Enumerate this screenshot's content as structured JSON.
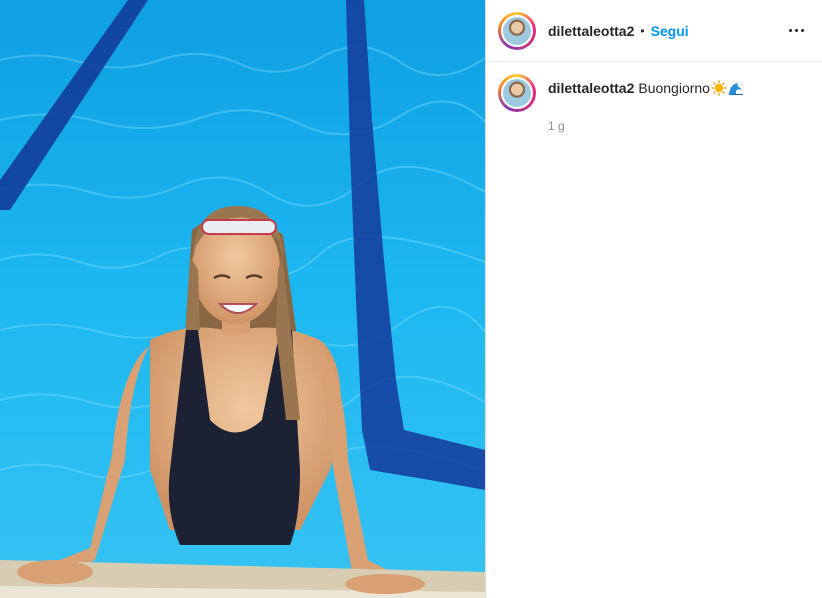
{
  "post": {
    "username": "dilettaleotta2",
    "dot": "•",
    "follow_label": "Segui",
    "more_icon": "more-options-icon",
    "caption_username": "dilettaleotta2",
    "caption_text": "Buongiorno",
    "caption_emojis": [
      "sun-emoji",
      "wave-emoji"
    ],
    "timestamp": "1 g"
  },
  "colors": {
    "follow": "#0095f6",
    "text": "#262626",
    "muted": "#8e8e8e",
    "pool": "#19b3ee"
  }
}
